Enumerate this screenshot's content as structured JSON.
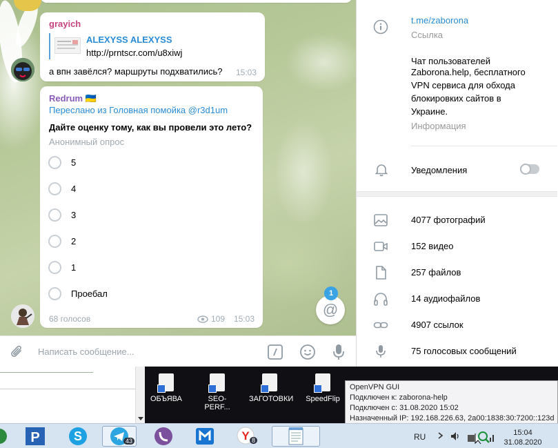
{
  "chat": {
    "msg1": {
      "sender": "grayich",
      "preview_title": "ALEXYSS ALEXYSS",
      "preview_url": "http://prntscr.com/u8xiwj",
      "text": "а впн завёлся?  маршруты подхватились?",
      "time": "15:03"
    },
    "poll": {
      "sender": "Redrum 🇺🇦",
      "forwarded": "Переслано из Головная помойка @r3d1um",
      "question": "Дайте оценку тому, как вы провели это лето?",
      "type": "Анонимный опрос",
      "options": [
        "5",
        "4",
        "3",
        "2",
        "1",
        "Проебал"
      ],
      "votes": "68 голосов",
      "views": "109",
      "time": "15:03"
    },
    "mention_count": "1",
    "compose_placeholder": "Написать сообщение...",
    "mention_symbol": "@"
  },
  "panel": {
    "link": "t.me/zaborona",
    "link_caption": "Ссылка",
    "description": [
      "Чат пользователей",
      "Zaborona.help, бесплатного",
      "VPN сервиса для обхода",
      "блокировких сайтов в",
      "Украине."
    ],
    "description_caption": "Информация",
    "notifications_label": "Уведомления",
    "notifications_on": false,
    "media": [
      {
        "label": "4077 фотографий",
        "icon": "photo-icon"
      },
      {
        "label": "152 видео",
        "icon": "video-icon"
      },
      {
        "label": "257 файлов",
        "icon": "file-icon"
      },
      {
        "label": "14 аудиофайлов",
        "icon": "headphones-icon"
      },
      {
        "label": "4907 ссылок",
        "icon": "link-icon"
      },
      {
        "label": "75 голосовых сообщений",
        "icon": "microphone-icon"
      }
    ]
  },
  "desktop": {
    "icons": [
      "ОБЪЯВА",
      "SEO-PERF...",
      "ЗАГОТОВКИ",
      "SpeedFlip"
    ]
  },
  "tooltip": {
    "title": "OpenVPN GUI",
    "line1": "Подключен к: zaborona-help",
    "line2": "Подключен с: 31.08.2020 15:02",
    "line3": "Назначенный IP: 192.168.226.63, 2a00:1838:30:7200::123d"
  },
  "taskbar": {
    "lang": "RU",
    "time": "15:04",
    "date": "31.08.2020",
    "telegram_badge": "43",
    "yandex_badge": "8"
  },
  "colors": {
    "accent": "#2a8cd6",
    "grayich": "#c7457f",
    "redrum": "#8a5bb8",
    "badge": "#3aa3e3"
  }
}
